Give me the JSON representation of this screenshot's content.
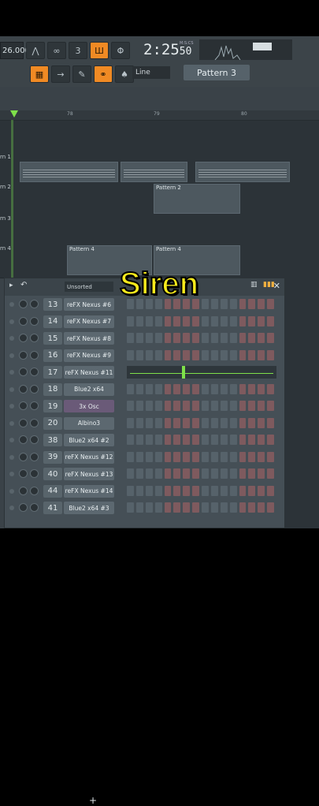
{
  "toolbar": {
    "tempo": "26.000",
    "clock_main": "2:25",
    "clock_sub": "50",
    "clock_unit": "M:S:CS",
    "snap": "Line",
    "pattern": "Pattern 3"
  },
  "timeline": {
    "bars": [
      "78",
      "79",
      "80"
    ]
  },
  "tracks": [
    {
      "label": "rn 1",
      "clips": []
    },
    {
      "label": "rn 2",
      "clips": [
        "Pattern 2"
      ]
    },
    {
      "label": "rn 3",
      "clips": []
    },
    {
      "label": "rn 4",
      "clips": [
        "Pattern 4",
        "Pattern 4"
      ]
    }
  ],
  "overlay_title": "Siren",
  "rack": {
    "filter": "Unsorted",
    "channels": [
      {
        "num": "13",
        "name": "reFX Nexus #6"
      },
      {
        "num": "14",
        "name": "reFX Nexus #7"
      },
      {
        "num": "15",
        "name": "reFX Nexus #8"
      },
      {
        "num": "16",
        "name": "reFX Nexus #9"
      },
      {
        "num": "17",
        "name": "reFX Nexus #11"
      },
      {
        "num": "18",
        "name": "Blue2 x64"
      },
      {
        "num": "19",
        "name": "3x Osc"
      },
      {
        "num": "20",
        "name": "Albino3"
      },
      {
        "num": "38",
        "name": "Blue2 x64 #2"
      },
      {
        "num": "39",
        "name": "reFX Nexus #12"
      },
      {
        "num": "40",
        "name": "reFX Nexus #13"
      },
      {
        "num": "44",
        "name": "reFX Nexus #14"
      },
      {
        "num": "41",
        "name": "Blue2 x64 #3"
      }
    ],
    "add_label": "+"
  }
}
